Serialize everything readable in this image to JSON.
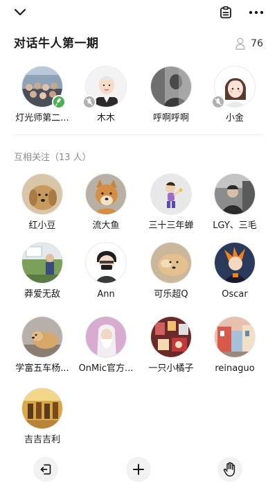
{
  "room": {
    "title": "对话牛人第一期",
    "listener_count": "76"
  },
  "icons": {
    "collapse": "chevron-down-icon",
    "clipboard": "clipboard-icon",
    "more": "more-dots-icon",
    "listeners": "person-outline-icon",
    "leave": "exit-icon",
    "add": "plus-icon",
    "raise_hand": "hand-icon"
  },
  "speakers": [
    {
      "name": "灯光师第二...",
      "mic": "on"
    },
    {
      "name": "木木",
      "mic": "off"
    },
    {
      "name": "呼啊呼啊",
      "mic": "none"
    },
    {
      "name": "小金",
      "mic": "off"
    }
  ],
  "mutual_section": {
    "title": "互相关注（13 人）"
  },
  "followers": [
    {
      "name": "红小豆"
    },
    {
      "name": "流大鱼"
    },
    {
      "name": "三十三年蝉"
    },
    {
      "name": "LGY、三毛"
    },
    {
      "name": "莽爱无敌"
    },
    {
      "name": "Ann"
    },
    {
      "name": "可乐超Q"
    },
    {
      "name": "Oscar"
    },
    {
      "name": "学富五车杨..."
    },
    {
      "name": "OnMic官方..."
    },
    {
      "name": "一只小橘子"
    },
    {
      "name": "reinaguo"
    },
    {
      "name": "吉吉吉利"
    }
  ],
  "colors": {
    "mic_on": "#4caf50",
    "mic_off": "#b0b0b0",
    "section_text": "#8a8a8a"
  }
}
